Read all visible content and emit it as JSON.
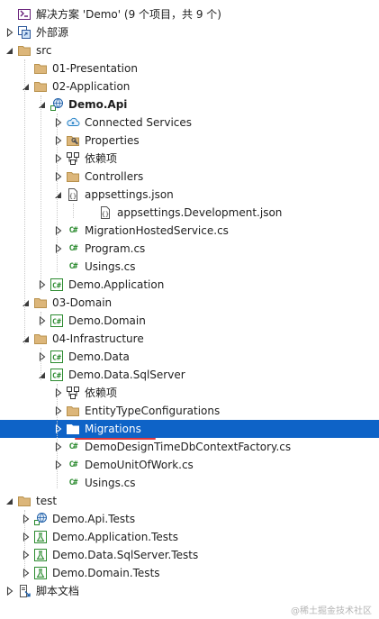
{
  "solution_explorer": {
    "rows": [
      {
        "key": "solution",
        "label": "解决方案 'Demo' (9 个项目，共 9 个)",
        "icon": "solution-icon",
        "level": 0,
        "expander": "none",
        "bold": false,
        "selected": false
      },
      {
        "key": "external-sources",
        "label": "外部源",
        "icon": "external-sources-icon",
        "level": 0,
        "expander": "collapsed",
        "bold": false,
        "selected": false
      },
      {
        "key": "src",
        "label": "src",
        "icon": "folder-icon",
        "level": 0,
        "expander": "expanded",
        "bold": false,
        "selected": false
      },
      {
        "key": "01-presentation",
        "label": "01-Presentation",
        "icon": "folder-icon",
        "level": 1,
        "expander": "none",
        "bold": false,
        "selected": false
      },
      {
        "key": "02-application",
        "label": "02-Application",
        "icon": "folder-icon",
        "level": 1,
        "expander": "expanded",
        "bold": false,
        "selected": false
      },
      {
        "key": "demo-api",
        "label": "Demo.Api",
        "icon": "web-project-icon",
        "level": 2,
        "expander": "expanded",
        "bold": true,
        "selected": false
      },
      {
        "key": "connected-services",
        "label": "Connected Services",
        "icon": "connected-services-icon",
        "level": 3,
        "expander": "collapsed",
        "bold": false,
        "selected": false
      },
      {
        "key": "properties",
        "label": "Properties",
        "icon": "properties-icon",
        "level": 3,
        "expander": "collapsed",
        "bold": false,
        "selected": false
      },
      {
        "key": "dependencies-api",
        "label": "依赖项",
        "icon": "dependencies-icon",
        "level": 3,
        "expander": "collapsed",
        "bold": false,
        "selected": false
      },
      {
        "key": "controllers",
        "label": "Controllers",
        "icon": "folder-icon",
        "level": 3,
        "expander": "collapsed",
        "bold": false,
        "selected": false
      },
      {
        "key": "appsettings",
        "label": "appsettings.json",
        "icon": "json-file-icon",
        "level": 3,
        "expander": "expanded",
        "bold": false,
        "selected": false
      },
      {
        "key": "appsettings-dev",
        "label": "appsettings.Development.json",
        "icon": "json-file-icon",
        "level": 4,
        "expander": "none",
        "bold": false,
        "selected": false
      },
      {
        "key": "migration-hosted-service",
        "label": "MigrationHostedService.cs",
        "icon": "csharp-file-icon",
        "level": 3,
        "expander": "collapsed",
        "bold": false,
        "selected": false
      },
      {
        "key": "program",
        "label": "Program.cs",
        "icon": "csharp-file-icon",
        "level": 3,
        "expander": "collapsed",
        "bold": false,
        "selected": false
      },
      {
        "key": "usings-api",
        "label": "Usings.cs",
        "icon": "csharp-file-icon",
        "level": 3,
        "expander": "none",
        "bold": false,
        "selected": false
      },
      {
        "key": "demo-application",
        "label": "Demo.Application",
        "icon": "csharp-project-icon",
        "level": 2,
        "expander": "collapsed",
        "bold": false,
        "selected": false
      },
      {
        "key": "03-domain",
        "label": "03-Domain",
        "icon": "folder-icon",
        "level": 1,
        "expander": "expanded",
        "bold": false,
        "selected": false
      },
      {
        "key": "demo-domain",
        "label": "Demo.Domain",
        "icon": "csharp-project-icon",
        "level": 2,
        "expander": "collapsed",
        "bold": false,
        "selected": false
      },
      {
        "key": "04-infrastructure",
        "label": "04-Infrastructure",
        "icon": "folder-icon",
        "level": 1,
        "expander": "expanded",
        "bold": false,
        "selected": false
      },
      {
        "key": "demo-data",
        "label": "Demo.Data",
        "icon": "csharp-project-icon",
        "level": 2,
        "expander": "collapsed",
        "bold": false,
        "selected": false
      },
      {
        "key": "demo-data-sqlserver",
        "label": "Demo.Data.SqlServer",
        "icon": "csharp-project-icon",
        "level": 2,
        "expander": "expanded",
        "bold": false,
        "selected": false
      },
      {
        "key": "dependencies-sql",
        "label": "依赖项",
        "icon": "dependencies-icon",
        "level": 3,
        "expander": "collapsed",
        "bold": false,
        "selected": false
      },
      {
        "key": "entity-type-configurations",
        "label": "EntityTypeConfigurations",
        "icon": "folder-icon",
        "level": 3,
        "expander": "collapsed",
        "bold": false,
        "selected": false
      },
      {
        "key": "migrations",
        "label": "Migrations",
        "icon": "folder-icon",
        "level": 3,
        "expander": "collapsed",
        "bold": false,
        "selected": true
      },
      {
        "key": "design-time-factory",
        "label": "DemoDesignTimeDbContextFactory.cs",
        "icon": "csharp-file-icon",
        "level": 3,
        "expander": "collapsed",
        "bold": false,
        "selected": false
      },
      {
        "key": "unit-of-work",
        "label": "DemoUnitOfWork.cs",
        "icon": "csharp-file-icon",
        "level": 3,
        "expander": "collapsed",
        "bold": false,
        "selected": false
      },
      {
        "key": "usings-sql",
        "label": "Usings.cs",
        "icon": "csharp-file-icon",
        "level": 3,
        "expander": "none",
        "bold": false,
        "selected": false
      },
      {
        "key": "test",
        "label": "test",
        "icon": "folder-icon",
        "level": 0,
        "expander": "expanded",
        "bold": false,
        "selected": false
      },
      {
        "key": "demo-api-tests",
        "label": "Demo.Api.Tests",
        "icon": "web-project-icon",
        "level": 1,
        "expander": "collapsed",
        "bold": false,
        "selected": false
      },
      {
        "key": "demo-application-tests",
        "label": "Demo.Application.Tests",
        "icon": "test-project-icon",
        "level": 1,
        "expander": "collapsed",
        "bold": false,
        "selected": false
      },
      {
        "key": "demo-data-sqlserver-tests",
        "label": "Demo.Data.SqlServer.Tests",
        "icon": "test-project-icon",
        "level": 1,
        "expander": "collapsed",
        "bold": false,
        "selected": false
      },
      {
        "key": "demo-domain-tests",
        "label": "Demo.Domain.Tests",
        "icon": "test-project-icon",
        "level": 1,
        "expander": "collapsed",
        "bold": false,
        "selected": false
      },
      {
        "key": "script-docs",
        "label": "脚本文档",
        "icon": "script-docs-icon",
        "level": 0,
        "expander": "collapsed",
        "bold": false,
        "selected": false
      }
    ]
  },
  "watermark": "@稀土掘金技术社区",
  "colors": {
    "selection": "#0e63c7",
    "folder": "#dcb67a",
    "csharp": "#2a8a2e",
    "annotation_underline": "#e0393e"
  }
}
